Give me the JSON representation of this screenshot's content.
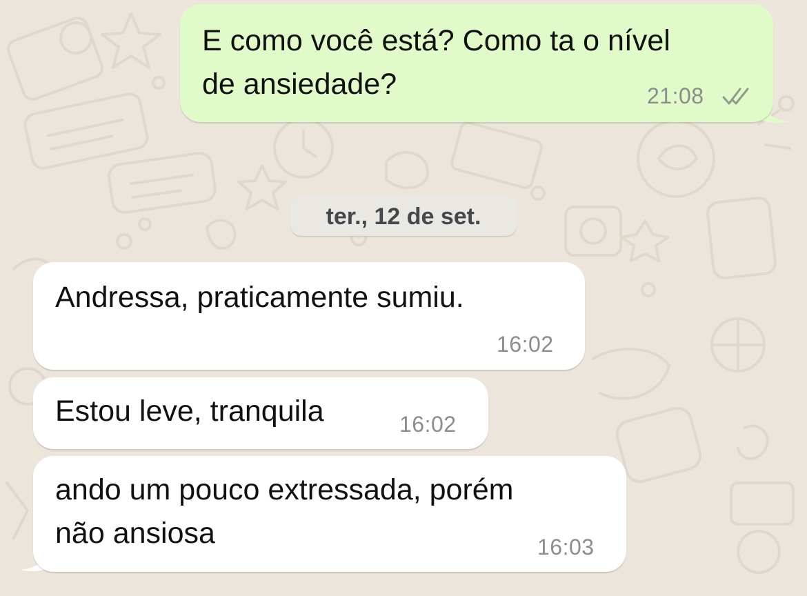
{
  "date_separator": "ter., 12 de set.",
  "messages": [
    {
      "direction": "outgoing",
      "text": "E como você está? Como ta o nível\nde ansiedade?",
      "time": "21:08",
      "status": "read"
    },
    {
      "direction": "incoming",
      "text": "Andressa, praticamente sumiu.",
      "time": "16:02"
    },
    {
      "direction": "incoming",
      "text": "Estou leve, tranquila",
      "time": "16:02"
    },
    {
      "direction": "incoming",
      "text": "ando um pouco extressada, porém\nnão ansiosa",
      "time": "16:03"
    }
  ],
  "colors": {
    "wallpaper": "#ece5dc",
    "outgoing_bubble": "#e1fac9",
    "incoming_bubble": "#ffffff",
    "timestamp": "#8a8d8a",
    "date_pill": "#eae8e2"
  },
  "icons": {
    "read_receipt": "double-check-icon"
  }
}
